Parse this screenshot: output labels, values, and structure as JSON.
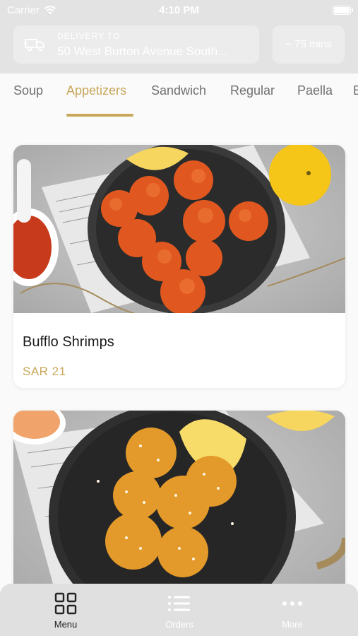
{
  "status_bar": {
    "carrier": "Carrier",
    "time": "4:10 PM"
  },
  "delivery": {
    "label": "DELIVERY TO",
    "address": "50 West Burton Avenue South...",
    "eta": "~ 75 mins"
  },
  "categories": [
    "Soup",
    "Appetizers",
    "Sandwich",
    "Regular",
    "Paella",
    "B"
  ],
  "active_category": "Appetizers",
  "menu_items": [
    {
      "name": "Bufflo Shrimps",
      "price": "SAR 21"
    },
    {
      "name": "",
      "price": ""
    }
  ],
  "tabbar": {
    "menu": "Menu",
    "orders": "Orders",
    "more": "More"
  },
  "colors": {
    "accent": "#c8a75a",
    "header_bg": "#e3e3e3",
    "tabbar_bg": "#e0e0e0"
  }
}
